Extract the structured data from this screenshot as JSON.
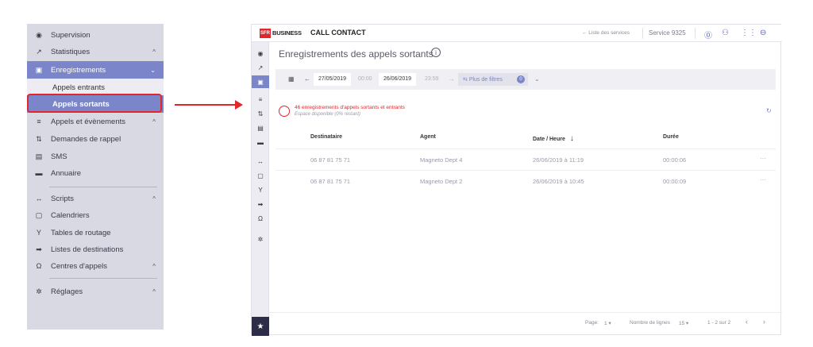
{
  "sidebar": {
    "items": [
      {
        "label": "Supervision",
        "icon": "eye-icon"
      },
      {
        "label": "Statistiques",
        "icon": "trend-icon"
      },
      {
        "label": "Enregistrements",
        "icon": "save-icon"
      },
      {
        "label": "Appels et évènements",
        "icon": "events-icon"
      },
      {
        "label": "Demandes de rappel",
        "icon": "callback-icon"
      },
      {
        "label": "SMS",
        "icon": "sms-icon"
      },
      {
        "label": "Annuaire",
        "icon": "directory-icon"
      },
      {
        "label": "Scripts",
        "icon": "code-icon"
      },
      {
        "label": "Calendriers",
        "icon": "calendar-icon"
      },
      {
        "label": "Tables de routage",
        "icon": "routing-icon"
      },
      {
        "label": "Listes de destinations",
        "icon": "destination-icon"
      },
      {
        "label": "Centres d'appels",
        "icon": "headset-icon"
      },
      {
        "label": "Réglages",
        "icon": "gear-icon"
      }
    ],
    "subitems": {
      "incoming": "Appels entrants",
      "outgoing": "Appels sortants"
    }
  },
  "header": {
    "logo_sfr": "SFR",
    "logo_business": "BUSINESS",
    "product": "CALL CONTACT",
    "services_link": "← Liste des services",
    "service_name": "Service 9325"
  },
  "page": {
    "title": "Enregistrements des appels sortants",
    "filters": {
      "date_from": "27/05/2019",
      "time_from": "00:00",
      "date_to": "26/06/2019",
      "time_to": "23:59",
      "more_filters": "Plus de filtres",
      "filter_count": "0"
    },
    "alert": {
      "message": "46 enregistrements d'appels sortants et entrants",
      "storage": "Espace disponible (0% restant)"
    },
    "table": {
      "headers": [
        "Destinataire",
        "Agent",
        "Date / Heure",
        "Durée"
      ],
      "rows": [
        {
          "destinataire": "06 87 81 75 71",
          "agent": "Magneto Dept 4",
          "date": "26/06/2019 à 11:19",
          "duree": "00:00:06"
        },
        {
          "destinataire": "06 87 81 75 71",
          "agent": "Magneto Dept 2",
          "date": "26/06/2019 à 10:45",
          "duree": "00:00:09"
        }
      ]
    },
    "footer": {
      "page_label": "Page:",
      "page_value": "1",
      "rows_label": "Nombre de lignes",
      "rows_value": "15",
      "range": "1 - 2 sur 2"
    }
  },
  "colors": {
    "accent": "#7a86c9",
    "brand_red": "#e3262b",
    "sidebar_bg": "#d9d9e3"
  }
}
